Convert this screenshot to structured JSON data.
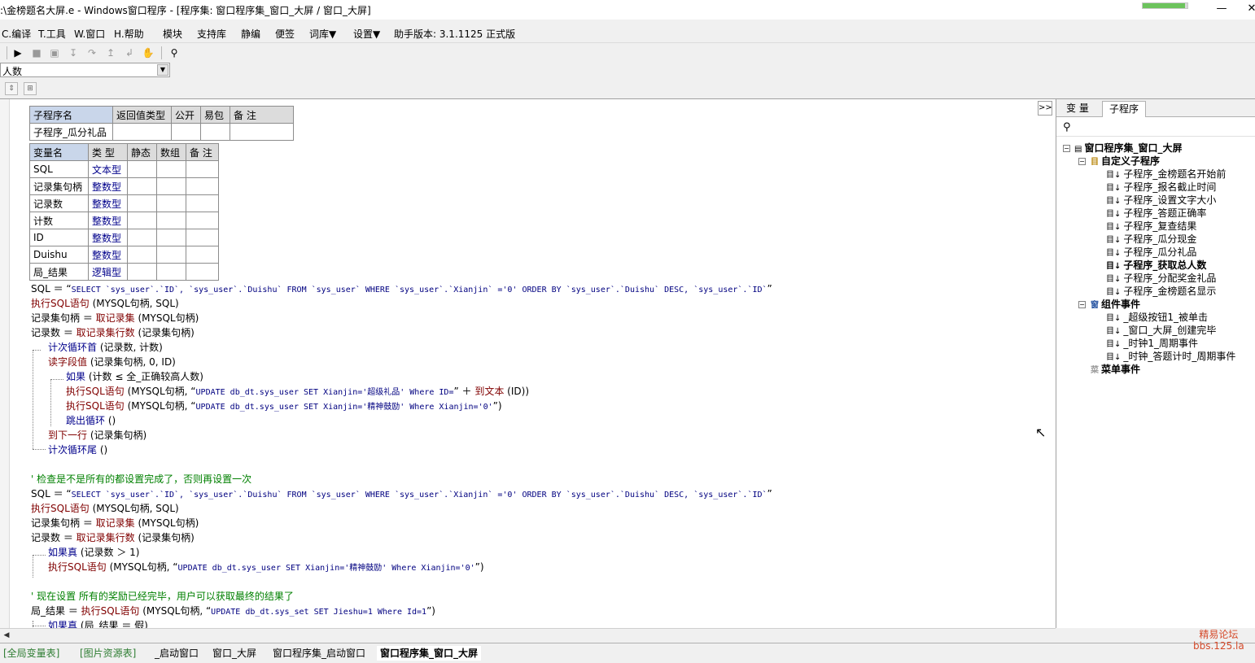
{
  "window": {
    "title": ":\\金榜题名大屏.e - Windows窗口程序 - [程序集: 窗口程序集_窗口_大屏 / 窗口_大屏]",
    "minimize": "—",
    "close": "✕"
  },
  "menu": {
    "items": [
      "C.编译",
      "T.工具",
      "W.窗口",
      "H.帮助",
      "模块",
      "支持库",
      "静编",
      "便签",
      "词库▼",
      "设置▼",
      "助手版本: 3.1.1125 正式版"
    ]
  },
  "combo": {
    "value": "人数"
  },
  "sub_table": {
    "headers": [
      "子程序名",
      "返回值类型",
      "公开",
      "易包",
      "备 注"
    ],
    "row": [
      "子程序_瓜分礼品",
      "",
      "",
      "",
      ""
    ]
  },
  "var_table": {
    "headers": [
      "变量名",
      "类 型",
      "静态",
      "数组",
      "备 注"
    ],
    "rows": [
      [
        "SQL",
        "文本型"
      ],
      [
        "记录集句柄",
        "整数型"
      ],
      [
        "记录数",
        "整数型"
      ],
      [
        "计数",
        "整数型"
      ],
      [
        "ID",
        "整数型"
      ],
      [
        "Duishu",
        "整数型"
      ],
      [
        "局_结果",
        "逻辑型"
      ]
    ]
  },
  "code": {
    "l1_a": "SQL ＝ “",
    "l1_sql": "SELECT `sys_user`.`ID`, `sys_user`.`Duishu` FROM `sys_user` WHERE `sys_user`.`Xianjin` ='0' ORDER BY `sys_user`.`Duishu` DESC, `sys_user`.`ID`",
    "l1_b": "”",
    "l2_kw": "执行SQL语句",
    "l2_args": " (MYSQL句柄, SQL)",
    "l3_a": "记录集句柄 ＝ ",
    "l3_kw": "取记录集",
    "l3_args": " (MYSQL句柄)",
    "l4_a": "记录数 ＝ ",
    "l4_kw": "取记录集行数",
    "l4_args": " (记录集句柄)",
    "l5_kw": "计次循环首",
    "l5_args": " (记录数, 计数)",
    "l6_kw": "读字段值",
    "l6_args": " (记录集句柄, 0, ID)",
    "l7_kw": "如果",
    "l7_args": " (计数 ≤ 全_正确较高人数)",
    "l8_kw": "执行SQL语句",
    "l8_a": " (MYSQL句柄, “",
    "l8_sql": "UPDATE db_dt.sys_user SET Xianjin='超级礼品' Where ID=",
    "l8_b": "” ＋ ",
    "l8_kw2": "到文本",
    "l8_c": " (ID))",
    "l9_kw": "执行SQL语句",
    "l9_a": " (MYSQL句柄, “",
    "l9_sql": "UPDATE db_dt.sys_user SET Xianjin='精神鼓励' Where Xianjin='0'",
    "l9_b": "”)",
    "l10_kw": "跳出循环",
    "l10_args": " ()",
    "l11_kw": "到下一行",
    "l11_args": " (记录集句柄)",
    "l12_kw": "计次循环尾",
    "l12_args": " ()",
    "c1": "' 检查是不是所有的都设置完成了，否则再设置一次",
    "l13_a": "SQL ＝ “",
    "l13_sql": "SELECT `sys_user`.`ID`, `sys_user`.`Duishu` FROM `sys_user` WHERE `sys_user`.`Xianjin` ='0' ORDER BY `sys_user`.`Duishu` DESC, `sys_user`.`ID`",
    "l13_b": "”",
    "l14_kw": "执行SQL语句",
    "l14_args": " (MYSQL句柄, SQL)",
    "l15_a": "记录集句柄 ＝ ",
    "l15_kw": "取记录集",
    "l15_args": " (MYSQL句柄)",
    "l16_a": "记录数 ＝ ",
    "l16_kw": "取记录集行数",
    "l16_args": " (记录集句柄)",
    "l17_kw": "如果真",
    "l17_args": " (记录数 ＞ 1)",
    "l18_kw": "执行SQL语句",
    "l18_a": " (MYSQL句柄, “",
    "l18_sql": "UPDATE db_dt.sys_user SET Xianjin='精神鼓励' Where Xianjin='0'",
    "l18_b": "”)",
    "c2": "' 现在设置 所有的奖励已经完毕，用户可以获取最终的结果了",
    "l19_a": "局_结果 ＝ ",
    "l19_kw": "执行SQL语句",
    "l19_a2": " (MYSQL句柄, “",
    "l19_sql": "UPDATE db_dt.sys_set SET Jieshu=1 Where Id=1",
    "l19_b": "”)",
    "l20_kw": "如果真",
    "l20_args": " (局_结果 ＝ 假)"
  },
  "right_panel": {
    "tabs": [
      "变 量",
      "子程序"
    ],
    "collapse_label": ">>",
    "root": "窗口程序集_窗口_大屏",
    "group1": "自定义子程序",
    "subs": [
      "子程序_金榜题名开始前",
      "子程序_报名截止时间",
      "子程序_设置文字大小",
      "子程序_答题正确率",
      "子程序_复查结果",
      "子程序_瓜分现金",
      "子程序_瓜分礼品",
      "子程序_获取总人数",
      "子程序_分配奖金礼品",
      "子程序_金榜题名显示"
    ],
    "group2": "组件事件",
    "events": [
      "_超级按钮1_被单击",
      "_窗口_大屏_创建完毕",
      "_时钟1_周期事件",
      "_时钟_答题计时_周期事件"
    ],
    "group3": "菜单事件"
  },
  "bottom_tabs": [
    "[全局变量表]",
    "[图片资源表]",
    "_启动窗口",
    "窗口_大屏",
    "窗口程序集_启动窗口",
    "窗口程序集_窗口_大屏"
  ],
  "watermark": {
    "line1": "精易论坛",
    "line2": "bbs.125.la"
  },
  "status": {
    "progress": 0.95
  }
}
